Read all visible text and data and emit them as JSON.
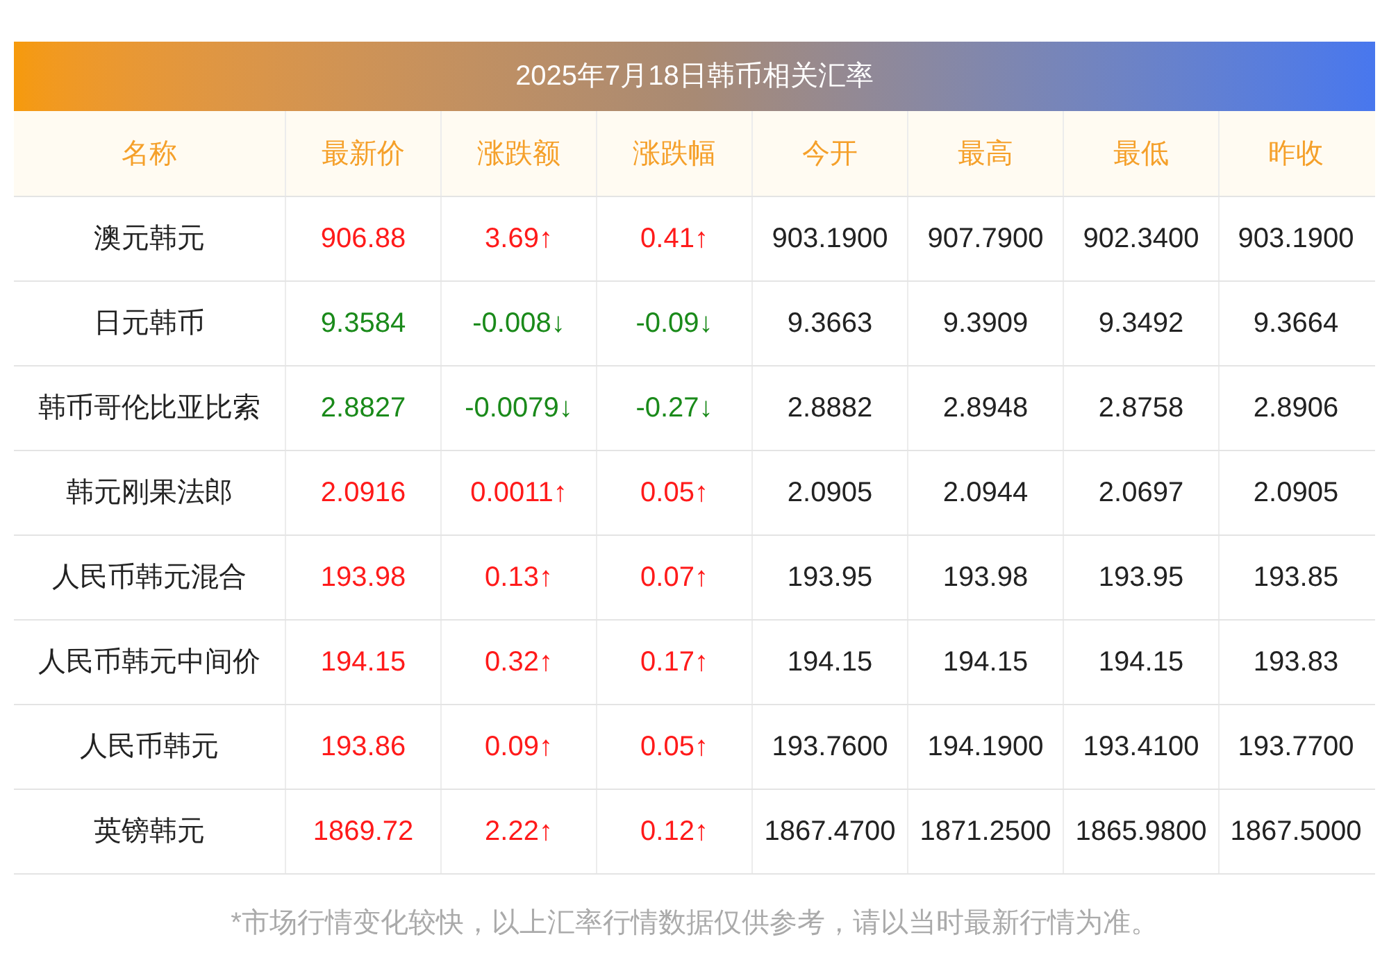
{
  "title": "2025年7月18日韩币相关汇率",
  "columns": [
    "名称",
    "最新价",
    "涨跌额",
    "涨跌幅",
    "今开",
    "最高",
    "最低",
    "昨收"
  ],
  "rows": [
    {
      "name": "澳元韩元",
      "rising": true,
      "latest": "906.88",
      "change": "3.69↑",
      "pct": "0.41↑",
      "open": "903.1900",
      "high": "907.7900",
      "low": "902.3400",
      "prev": "903.1900"
    },
    {
      "name": "日元韩币",
      "rising": false,
      "latest": "9.3584",
      "change": "-0.008↓",
      "pct": "-0.09↓",
      "open": "9.3663",
      "high": "9.3909",
      "low": "9.3492",
      "prev": "9.3664"
    },
    {
      "name": "韩币哥伦比亚比索",
      "rising": false,
      "latest": "2.8827",
      "change": "-0.0079↓",
      "pct": "-0.27↓",
      "open": "2.8882",
      "high": "2.8948",
      "low": "2.8758",
      "prev": "2.8906"
    },
    {
      "name": "韩元刚果法郎",
      "rising": true,
      "latest": "2.0916",
      "change": "0.0011↑",
      "pct": "0.05↑",
      "open": "2.0905",
      "high": "2.0944",
      "low": "2.0697",
      "prev": "2.0905"
    },
    {
      "name": "人民币韩元混合",
      "rising": true,
      "latest": "193.98",
      "change": "0.13↑",
      "pct": "0.07↑",
      "open": "193.95",
      "high": "193.98",
      "low": "193.95",
      "prev": "193.85"
    },
    {
      "name": "人民币韩元中间价",
      "rising": true,
      "latest": "194.15",
      "change": "0.32↑",
      "pct": "0.17↑",
      "open": "194.15",
      "high": "194.15",
      "low": "194.15",
      "prev": "193.83"
    },
    {
      "name": "人民币韩元",
      "rising": true,
      "latest": "193.86",
      "change": "0.09↑",
      "pct": "0.05↑",
      "open": "193.7600",
      "high": "194.1900",
      "low": "193.4100",
      "prev": "193.7700"
    },
    {
      "name": "英镑韩元",
      "rising": true,
      "latest": "1869.72",
      "change": "2.22↑",
      "pct": "0.12↑",
      "open": "1867.4700",
      "high": "1871.2500",
      "low": "1865.9800",
      "prev": "1867.5000"
    }
  ],
  "footnote": "*市场行情变化较快，以上汇率行情数据仅供参考，请以当时最新行情为准。"
}
